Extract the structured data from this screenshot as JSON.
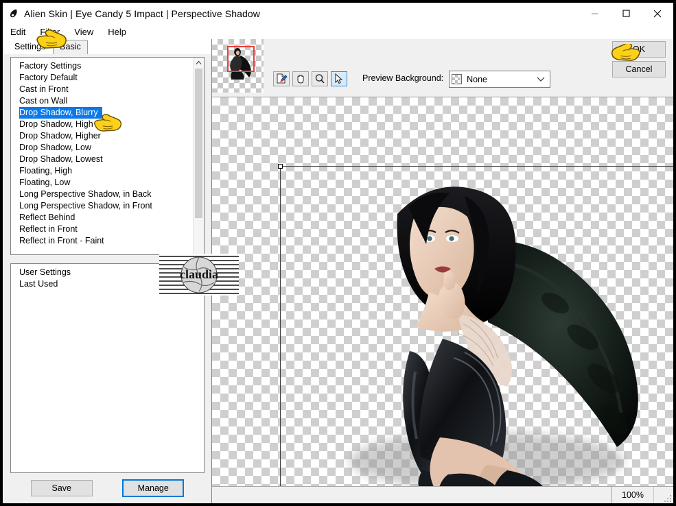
{
  "window": {
    "title": "Alien Skin | Eye Candy 5 Impact | Perspective Shadow",
    "icon": "droplet-icon",
    "minimize_label": "Minimize",
    "maximize_label": "Maximize",
    "close_label": "Close"
  },
  "menubar": {
    "items": [
      {
        "label": "Edit",
        "name": "menu-edit"
      },
      {
        "label": "Filter",
        "name": "menu-filter"
      },
      {
        "label": "View",
        "name": "menu-view"
      },
      {
        "label": "Help",
        "name": "menu-help"
      }
    ]
  },
  "tabs": [
    {
      "label": "Settings",
      "active": true
    },
    {
      "label": "Basic",
      "active": false
    }
  ],
  "settings_list": {
    "items": [
      "Factory Settings",
      "Factory Default",
      "Cast in Front",
      "Cast on Wall",
      "Drop Shadow, Blurry",
      "Drop Shadow, High",
      "Drop Shadow, Higher",
      "Drop Shadow, Low",
      "Drop Shadow, Lowest",
      "Floating, High",
      "Floating, Low",
      "Long Perspective Shadow, in Back",
      "Long Perspective Shadow, in Front",
      "Reflect Behind",
      "Reflect in Front",
      "Reflect in Front - Faint"
    ],
    "selected": "Drop Shadow, Blurry",
    "selected_index": 4,
    "selection_color": "#0b79e8",
    "selection_text_color": "#ffffff"
  },
  "user_list": {
    "items": [
      "User Settings",
      "Last Used"
    ]
  },
  "panel_buttons": {
    "save_label": "Save",
    "manage_label": "Manage",
    "manage_focus_color": "#0078d7"
  },
  "preview": {
    "thumbnail_name": "navigator-thumbnail",
    "viewport_color": "#e8403a",
    "tools": [
      {
        "name": "eyedropper-tool-button",
        "icon": "eyedropper-icon",
        "active": false
      },
      {
        "name": "hand-tool-button",
        "icon": "hand-icon",
        "active": false
      },
      {
        "name": "zoom-tool-button",
        "icon": "magnifier-icon",
        "active": false
      },
      {
        "name": "select-tool-button",
        "icon": "arrow-cursor-icon",
        "active": true
      }
    ],
    "background_label": "Preview Background:",
    "background_value": "None",
    "background_swatch": "checkerboard",
    "background_options": [
      "None"
    ]
  },
  "actions": {
    "ok_label": "OK",
    "cancel_label": "Cancel"
  },
  "statusbar": {
    "zoom": "100%",
    "message": ""
  },
  "canvas": {
    "watermark_text": "claudia",
    "checker_light": "#ffffff",
    "checker_dark": "#cfcfcf"
  },
  "cursors": [
    {
      "name": "pointer-cursor-filter-menu",
      "target": "Filter"
    },
    {
      "name": "pointer-cursor-settings-item",
      "target": "Drop Shadow, Blurry"
    },
    {
      "name": "pointer-cursor-ok-button",
      "target": "OK"
    }
  ]
}
